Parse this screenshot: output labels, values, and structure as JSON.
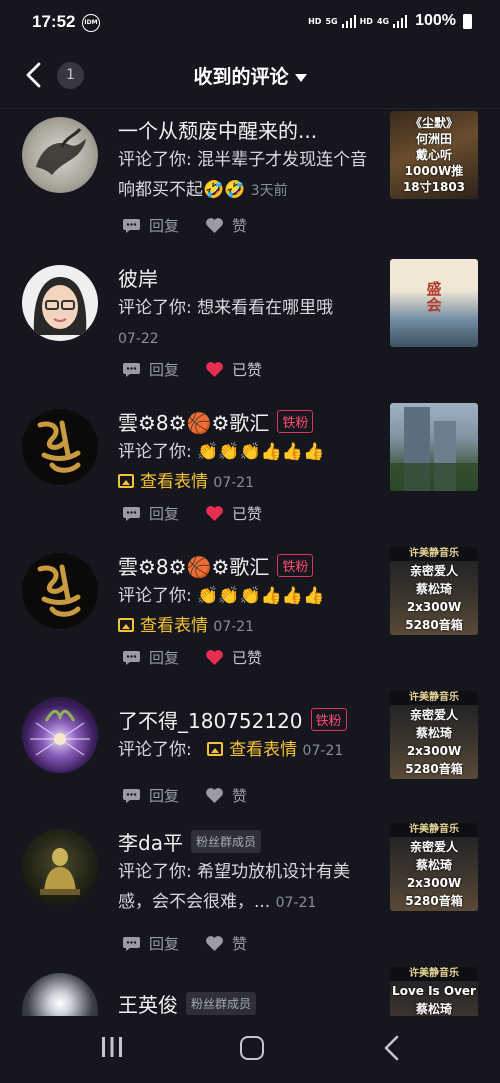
{
  "status": {
    "time": "17:52",
    "idm": "IDM",
    "net_labels": [
      "HD",
      "5G",
      "HD",
      "4G"
    ],
    "battery": "100%"
  },
  "nav": {
    "badge_count": "1",
    "title": "收到的评论"
  },
  "labels": {
    "reply": "回复",
    "like": "赞",
    "liked": "已赞",
    "sticker": "查看表情",
    "fan_tag": "铁粉",
    "group_tag": "粉丝群成员",
    "comment_prefix": "评论了你:"
  },
  "items": [
    {
      "name": "一个从颓废中醒来的...",
      "text": "混半辈子才发现连个音响都买不起🤣🤣",
      "time": "3天前",
      "like_label": "赞",
      "liked": false,
      "thumb_lines": [
        "《尘默》",
        "何洲田",
        "戴心听",
        "1000W推",
        "18寸1803"
      ]
    },
    {
      "name": "彼岸",
      "text": "想来看看在哪里哦",
      "time": "07-22",
      "like_label": "已赞",
      "liked": true,
      "thumb_lines": [
        "盛",
        "会"
      ]
    },
    {
      "name": "雲⚙8⚙🏀⚙歌汇",
      "tag": "铁粉",
      "emoji": "👏👏👏👍👍👍",
      "sticker": "查看表情",
      "time": "07-21",
      "like_label": "已赞",
      "liked": true
    },
    {
      "name": "雲⚙8⚙🏀⚙歌汇",
      "tag": "铁粉",
      "emoji": "👏👏👏👍👍👍",
      "sticker": "查看表情",
      "time": "07-21",
      "like_label": "已赞",
      "liked": true,
      "thumb_lines": [
        "亲密爱人",
        "蔡松琦",
        "2x300W",
        "5280音箱"
      ]
    },
    {
      "name": "了不得_180752120",
      "tag": "铁粉",
      "sticker": "查看表情",
      "time": "07-21",
      "like_label": "赞",
      "liked": false,
      "thumb_lines": [
        "亲密爱人",
        "蔡松琦",
        "2x300W",
        "5280音箱"
      ]
    },
    {
      "name": "李da平",
      "tag": "粉丝群成员",
      "text": "希望功放机设计有美感，会不会很难，...",
      "time": "07-21",
      "like_label": "赞",
      "liked": false,
      "thumb_lines": [
        "亲密爱人",
        "蔡松琦",
        "2x300W",
        "5280音箱"
      ]
    },
    {
      "name": "王英俊",
      "tag": "粉丝群成员",
      "thumb_lines": [
        "Love Is Over",
        "蔡松琦"
      ]
    }
  ],
  "thumb_header": "许美静音乐",
  "colors": {
    "background": "#15161e",
    "fan_tag": "#e0345a",
    "sticker": "#f5c435",
    "heart": "#e8304e"
  }
}
